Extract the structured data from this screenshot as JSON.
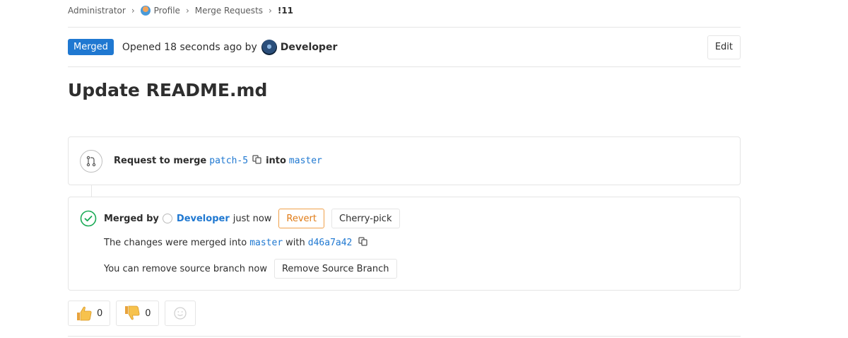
{
  "breadcrumb": {
    "items": [
      "Administrator",
      "Profile",
      "Merge Requests",
      "!11"
    ]
  },
  "header": {
    "status_badge": "Merged",
    "opened_text": "Opened 18 seconds ago by",
    "author": "Developer",
    "edit_label": "Edit"
  },
  "title": "Update README.md",
  "widget": {
    "request_prefix": "Request to merge",
    "source_branch": "patch-5",
    "into_label": "into",
    "target_branch": "master",
    "merged_by_label": "Merged by",
    "merged_by_user": "Developer",
    "merged_time": "just now",
    "revert_label": "Revert",
    "cherry_pick_label": "Cherry-pick",
    "merged_into_text": "The changes were merged into",
    "merged_into_branch": "master",
    "with_label": "with",
    "commit_sha": "d46a7a42",
    "remove_text": "You can remove source branch now",
    "remove_button": "Remove Source Branch"
  },
  "awards": {
    "thumbsup_count": "0",
    "thumbsdown_count": "0"
  },
  "colors": {
    "accent": "#1f78d1",
    "success": "#1aaa55",
    "warning": "#e07b16"
  }
}
